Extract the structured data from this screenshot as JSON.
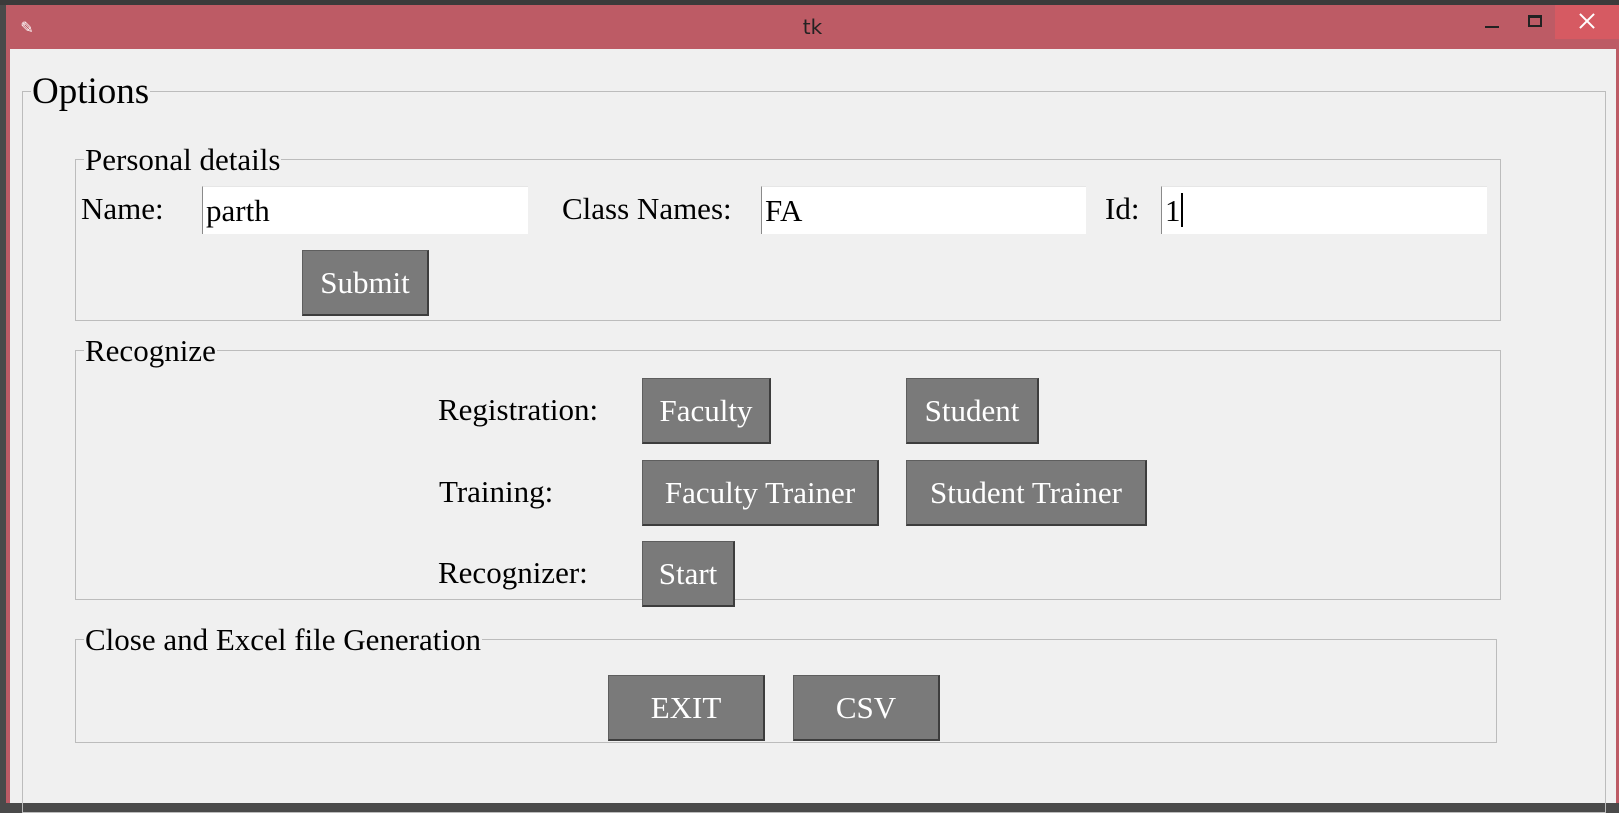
{
  "window": {
    "title": "tk"
  },
  "options_frame": {
    "title": "Options"
  },
  "personal_details": {
    "title": "Personal details",
    "name_label": "Name:",
    "name_value": "parth",
    "class_label": "Class Names:",
    "class_value": "FA",
    "id_label": "Id:",
    "id_value": "1",
    "submit_label": "Submit"
  },
  "recognize": {
    "title": "Recognize",
    "registration_label": "Registration:",
    "faculty_button": "Faculty",
    "student_button": "Student",
    "training_label": "Training:",
    "faculty_trainer_button": "Faculty Trainer",
    "student_trainer_button": "Student Trainer",
    "recognizer_label": "Recognizer:",
    "start_button": "Start"
  },
  "close_excel": {
    "title": "Close and Excel file Generation",
    "exit_button": "EXIT",
    "csv_button": "CSV"
  },
  "colors": {
    "titlebar": "#bd5b65",
    "close_button": "#d65a62",
    "button_bg": "#7a7a7a",
    "button_text": "#ffffff",
    "client_bg": "#f0f0f0"
  },
  "icons": {
    "app": "tk-feather-icon"
  }
}
